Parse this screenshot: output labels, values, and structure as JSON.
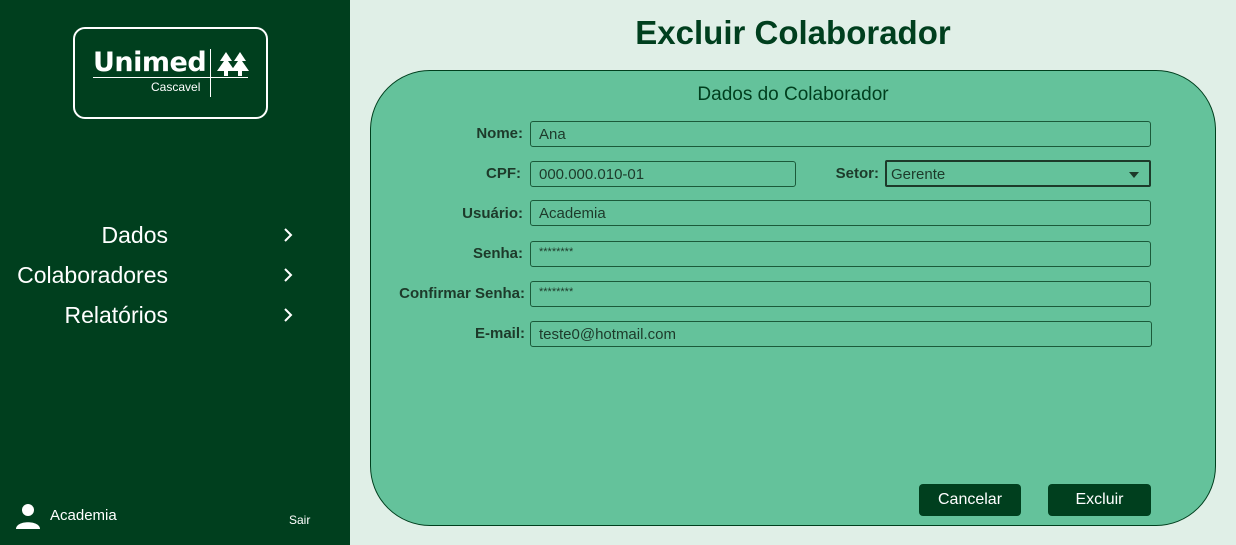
{
  "sidebar": {
    "logo": {
      "word": "Unimed",
      "sub": "Cascavel",
      "mark_icon": "unimed-tree-icon"
    },
    "nav": [
      {
        "label": "Dados",
        "icon": "chevron-right-icon"
      },
      {
        "label": "Colaboradores",
        "icon": "chevron-right-icon"
      },
      {
        "label": "Relatórios",
        "icon": "chevron-right-icon"
      }
    ],
    "user": {
      "icon": "user-icon",
      "name": "Academia",
      "logout_label": "Sair"
    }
  },
  "main": {
    "title": "Excluir Colaborador",
    "card": {
      "title": "Dados do Colaborador",
      "fields": {
        "nome": {
          "label": "Nome:",
          "value": "Ana"
        },
        "cpf": {
          "label": "CPF:",
          "value": "000.000.010-01"
        },
        "setor": {
          "label": "Setor:",
          "value": "Gerente"
        },
        "usuario": {
          "label": "Usuário:",
          "value": "Academia"
        },
        "senha": {
          "label": "Senha:",
          "value": "********"
        },
        "confirmar": {
          "label": "Confirmar Senha:",
          "value": "********"
        },
        "email": {
          "label": "E-mail:",
          "value": "teste0@hotmail.com"
        }
      },
      "buttons": {
        "cancel": "Cancelar",
        "delete": "Excluir"
      }
    }
  },
  "colors": {
    "sidebar": "#003f1e",
    "background": "#e0efe7",
    "card": "#64c29b",
    "text_dark": "#003f1e"
  }
}
